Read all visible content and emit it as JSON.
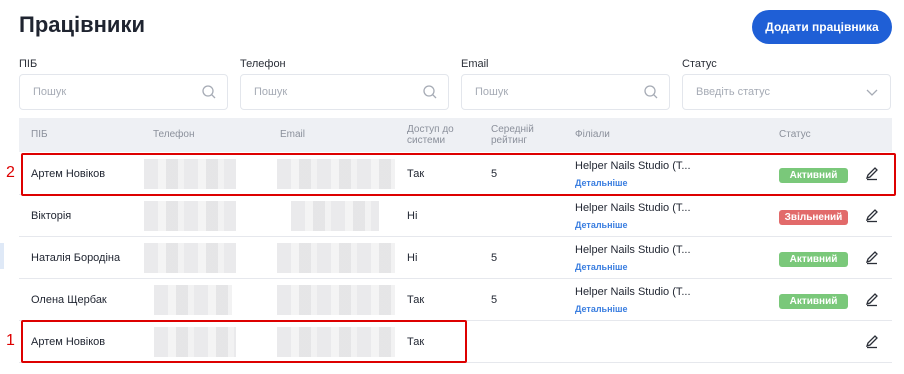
{
  "header": {
    "title": "Працівники",
    "add_button": "Додати працівника"
  },
  "filters": [
    {
      "label": "ПІБ",
      "placeholder": "Пошук",
      "icon": "search-icon"
    },
    {
      "label": "Телефон",
      "placeholder": "Пошук",
      "icon": "search-icon"
    },
    {
      "label": "Email",
      "placeholder": "Пошук",
      "icon": "search-icon"
    },
    {
      "label": "Статус",
      "placeholder": "Введіть статус",
      "icon": "chevron-down-icon"
    }
  ],
  "table": {
    "columns": [
      "ПІБ",
      "Телефон",
      "Email",
      "Доступ до системи",
      "Середній рейтинг",
      "Філіали",
      "Статус"
    ],
    "rows": [
      {
        "name": "Артем Новіков",
        "access": "Так",
        "rating": "5",
        "branch": "Helper Nails Studio (Т...",
        "details": "Детальніше",
        "status": "Активний",
        "status_color": "#7ac87a"
      },
      {
        "name": "Вікторія",
        "access": "Ні",
        "rating": "",
        "branch": "Helper Nails Studio (Т...",
        "details": "Детальніше",
        "status": "Звільнений",
        "status_color": "#e26a6a"
      },
      {
        "name": "Наталія Бородіна",
        "access": "Ні",
        "rating": "5",
        "branch": "Helper Nails Studio (Т...",
        "details": "Детальніше",
        "status": "Активний",
        "status_color": "#7ac87a"
      },
      {
        "name": "Олена Щербак",
        "access": "Так",
        "rating": "5",
        "branch": "Helper Nails Studio (Т...",
        "details": "Детальніше",
        "status": "Активний",
        "status_color": "#7ac87a"
      },
      {
        "name": "Артем Новіков",
        "access": "Так",
        "rating": "",
        "branch": "",
        "details": "",
        "status": "",
        "status_color": ""
      }
    ]
  },
  "annotations": {
    "marker_1": "1",
    "marker_2": "2",
    "color": "#dd0000"
  },
  "colors": {
    "accent": "#1f5fd6",
    "active": "#7ac87a",
    "fired": "#e26a6a",
    "link": "#3a7ee0"
  }
}
